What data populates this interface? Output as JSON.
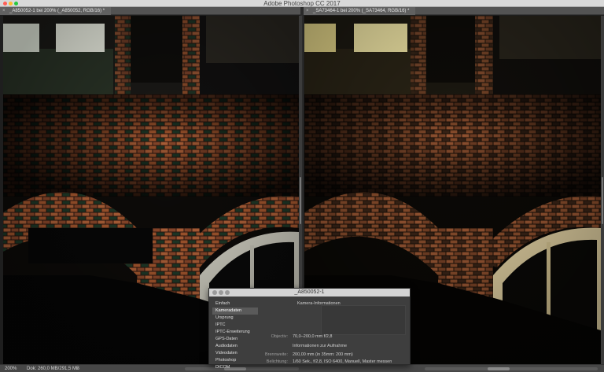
{
  "app": {
    "title": "Adobe Photoshop CC 2017"
  },
  "documents": [
    {
      "tab_label": "_A850052-1 bei 200% (_A850052, RGB/16) *",
      "close": "×"
    },
    {
      "tab_label": "_SA73464-1 bei 200% (_SA73464, RGB/16) *",
      "close": "×"
    }
  ],
  "status": {
    "zoom": "200%",
    "doc_info": "Dok: 260,0 MB/291,5 MB",
    "arrow": "›"
  },
  "dialog": {
    "title": "_A850052-1",
    "nav_items": [
      "Einfach",
      "Kameradaten",
      "Ursprung",
      "IPTC",
      "IPTC-Erweiterung",
      "GPS-Daten",
      "Audiodaten",
      "Videodaten",
      "Photoshop",
      "DICOM"
    ],
    "active_index": 1,
    "camera_section": "Kamera-Informationen",
    "objective_label": "Objectiv:",
    "objective_value": "70,0–200,0 mm f/2,8",
    "capture_section": "Informationen zur Aufnahme",
    "focal_label": "Brennweite:",
    "focal_value": "200,00 mm   (in 35mm: 200 mm)",
    "exposure_label": "Belichtung:",
    "exposure_value": "1/60 Sek.,    f/2,8,    ISO 6400,    Manuell,    Master messen"
  },
  "colors": {
    "accent_active": "#5a5a5a",
    "brick": "#b5643a",
    "window_light": "#f2f1d8",
    "window_warm": "#e6d78a"
  },
  "icons": {
    "close": "close-icon",
    "traffic": "window-control-icon"
  }
}
